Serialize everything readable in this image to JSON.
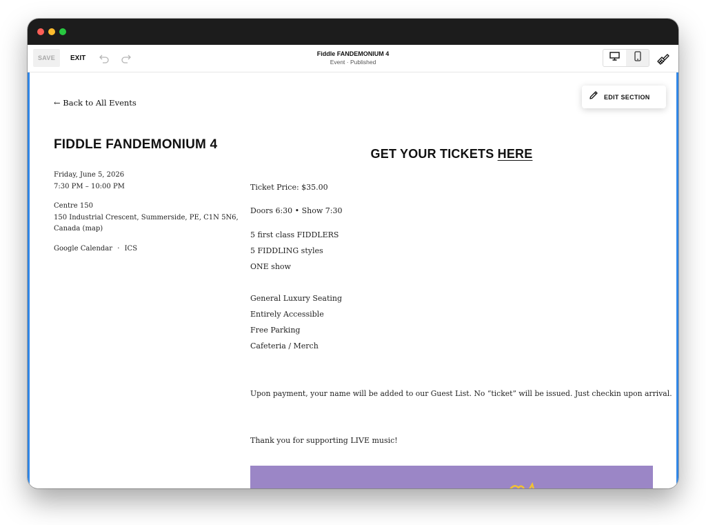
{
  "toolbar": {
    "save_label": "SAVE",
    "exit_label": "EXIT",
    "page_title": "Fiddle FANDEMONIUM 4",
    "page_status": "Event · Published",
    "undo_icon": "undo-icon",
    "redo_icon": "redo-icon",
    "desktop_icon": "desktop-icon",
    "mobile_icon": "mobile-icon",
    "design_icon": "paintbrush-icon"
  },
  "edit_section": {
    "label": "EDIT SECTION",
    "icon": "pencil-icon"
  },
  "event": {
    "back_link": "← Back to All Events",
    "title": "FIDDLE FANDEMONIUM 4",
    "date": "Friday, June 5, 2026",
    "time": "7:30 PM – 10:00 PM",
    "venue_name": "Centre 150",
    "venue_address_1": "150 Industrial Crescent, Summerside, PE, C1N 5N6,",
    "venue_address_2": "Canada (map)",
    "google_calendar": "Google Calendar",
    "separator": "·",
    "ics": "ICS"
  },
  "details": {
    "tickets_heading": "GET YOUR TICKETS",
    "tickets_link": "HERE",
    "lines": [
      "Ticket Price: $35.00",
      "Doors 6:30 • Show 7:30",
      "5 first class FIDDLERS",
      "5 FIDDLING styles",
      "ONE show",
      "General Luxury Seating",
      "Entirely Accessible",
      "Free Parking",
      "Cafeteria / Merch",
      "Upon payment, your name will be added to our Guest List. No “ticket” will be issued. Just checkin upon arrival.",
      "Thank you for supporting LIVE music!"
    ]
  },
  "colors": {
    "selection_border": "#2f86e6",
    "banner_purple": "#9b86c6",
    "banner_accent": "#f2c230"
  }
}
